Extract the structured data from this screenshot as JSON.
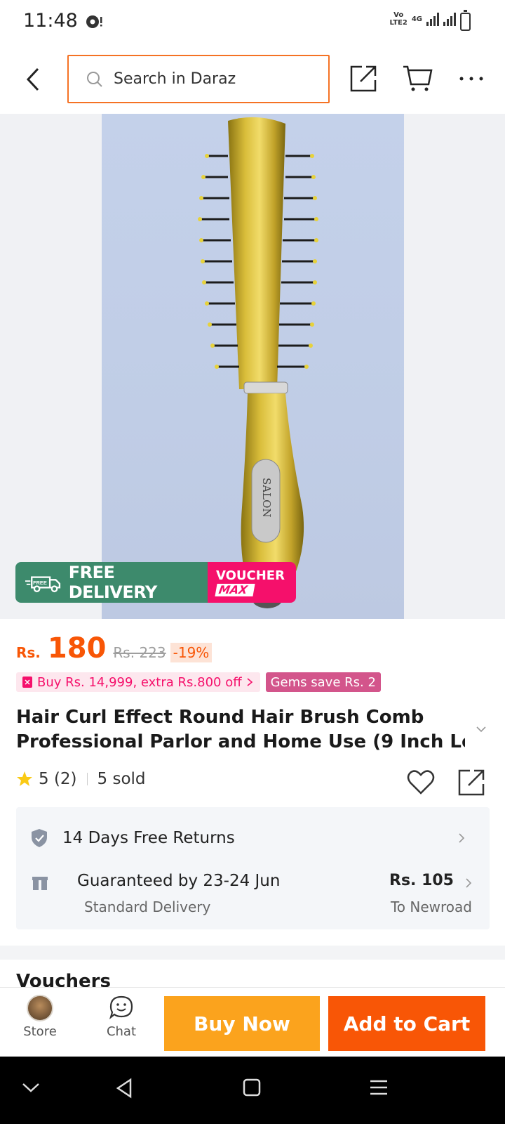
{
  "status_bar": {
    "time": "11:48",
    "network_top": "Vo",
    "network_bottom": "LTE2",
    "net_type": "4G"
  },
  "header": {
    "search_placeholder": "Search in Daraz"
  },
  "product": {
    "badge_free_delivery": "FREE DELIVERY",
    "badge_free_small": "FREE",
    "badge_voucher": "VOUCHER",
    "badge_max": "MAX",
    "price_currency": "Rs.",
    "price": "180",
    "original_price": "Rs. 223",
    "discount": "-19%",
    "promo_buy": "Buy Rs. 14,999, extra Rs.800 off",
    "promo_gems": "Gems save Rs. 2",
    "title_line1": "Hair Curl Effect Round Hair Brush Comb",
    "title_line2": "Professional Parlor and Home Use (9 Inch Le...",
    "rating": "5 (2)",
    "sold": "5 sold",
    "brand_text": "SALON"
  },
  "services": {
    "returns": "14 Days Free Returns",
    "delivery_title": "Guaranteed by 23-24 Jun",
    "delivery_sub": "Standard Delivery",
    "delivery_fee": "Rs. 105",
    "delivery_to": "To Newroad"
  },
  "sections": {
    "vouchers": "Vouchers"
  },
  "action_bar": {
    "store_label": "Store",
    "chat_label": "Chat",
    "buy_now": "Buy Now",
    "add_to_cart": "Add to Cart"
  },
  "colors": {
    "accent": "#f85606",
    "buy_now": "#fba31d",
    "free_delivery": "#3d8a6c",
    "voucher": "#f5106b"
  }
}
